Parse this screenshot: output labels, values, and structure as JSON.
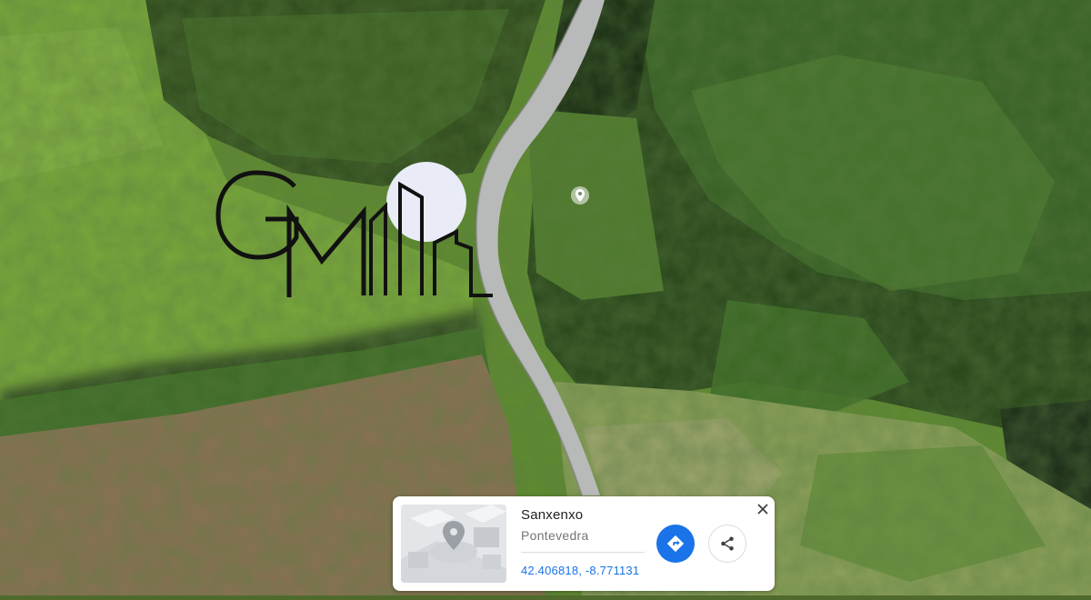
{
  "map": {
    "view": "satellite",
    "icons": [
      "location-pin-icon"
    ]
  },
  "logo": {
    "text": "GM",
    "accent_color": "#e9ecf6"
  },
  "place_card": {
    "name": "Sanxenxo",
    "region": "Pontevedra",
    "coordinates": "42.406818, -8.771131",
    "accent_color": "#1a73e8",
    "icons": [
      "directions-icon",
      "share-icon",
      "close-icon",
      "map-thumbnail-pin-icon"
    ]
  }
}
